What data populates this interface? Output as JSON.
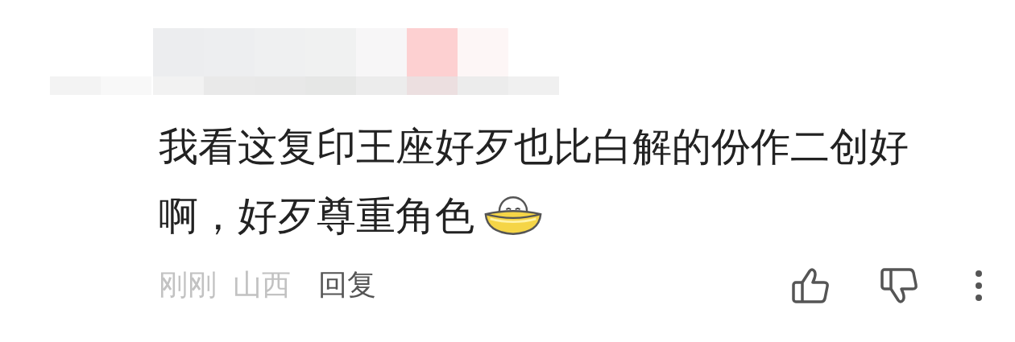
{
  "comment": {
    "text": "我看这复印王座好歹也比白解的份作二创好啊，好歹尊重角色",
    "time": "刚刚",
    "location": "山西",
    "reply": "回复"
  }
}
